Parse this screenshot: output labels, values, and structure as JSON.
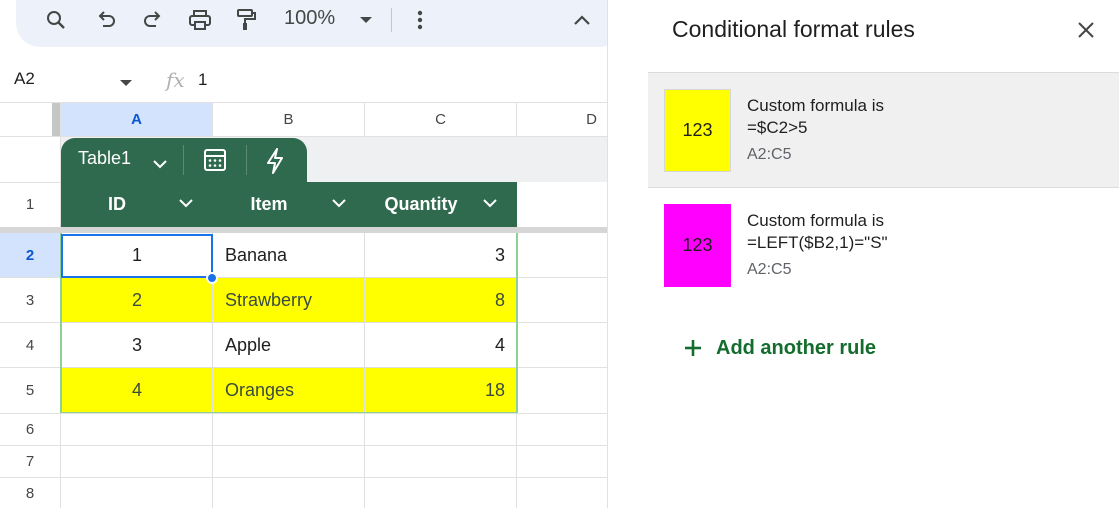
{
  "toolbar": {
    "zoom": "100%",
    "icons": [
      "search-icon",
      "undo-icon",
      "redo-icon",
      "print-icon",
      "paint-format-icon",
      "chevron-down-icon",
      "more-vert-icon",
      "collapse-icon"
    ]
  },
  "formula_bar": {
    "name_box": "A2",
    "fx": "fx",
    "value": "1"
  },
  "grid": {
    "columns": [
      "A",
      "B",
      "C",
      "D"
    ],
    "rows": [
      "1",
      "2",
      "3",
      "4",
      "5",
      "6",
      "7",
      "8"
    ]
  },
  "table": {
    "name": "Table1",
    "headers": [
      "ID",
      "Item",
      "Quantity"
    ],
    "rows": [
      {
        "id": "1",
        "item": "Banana",
        "qty": "3"
      },
      {
        "id": "2",
        "item": "Strawberry",
        "qty": "8"
      },
      {
        "id": "3",
        "item": "Apple",
        "qty": "4"
      },
      {
        "id": "4",
        "item": "Oranges",
        "qty": "18"
      }
    ]
  },
  "colors": {
    "table_green": "#2f6a4f",
    "highlight_yellow": "#ffff00",
    "highlight_magenta": "#ff00ff",
    "selection_blue": "#1a73e8",
    "add_green": "#146c2e"
  },
  "panel": {
    "title": "Conditional format rules",
    "rules": [
      {
        "preview": "123",
        "line1": "Custom formula is",
        "line2": "=$C2>5",
        "range": "A2:C5"
      },
      {
        "preview": "123",
        "line1": "Custom formula is",
        "line2": "=LEFT($B2,1)=\"S\"",
        "range": "A2:C5"
      }
    ],
    "add_label": "Add another rule"
  }
}
